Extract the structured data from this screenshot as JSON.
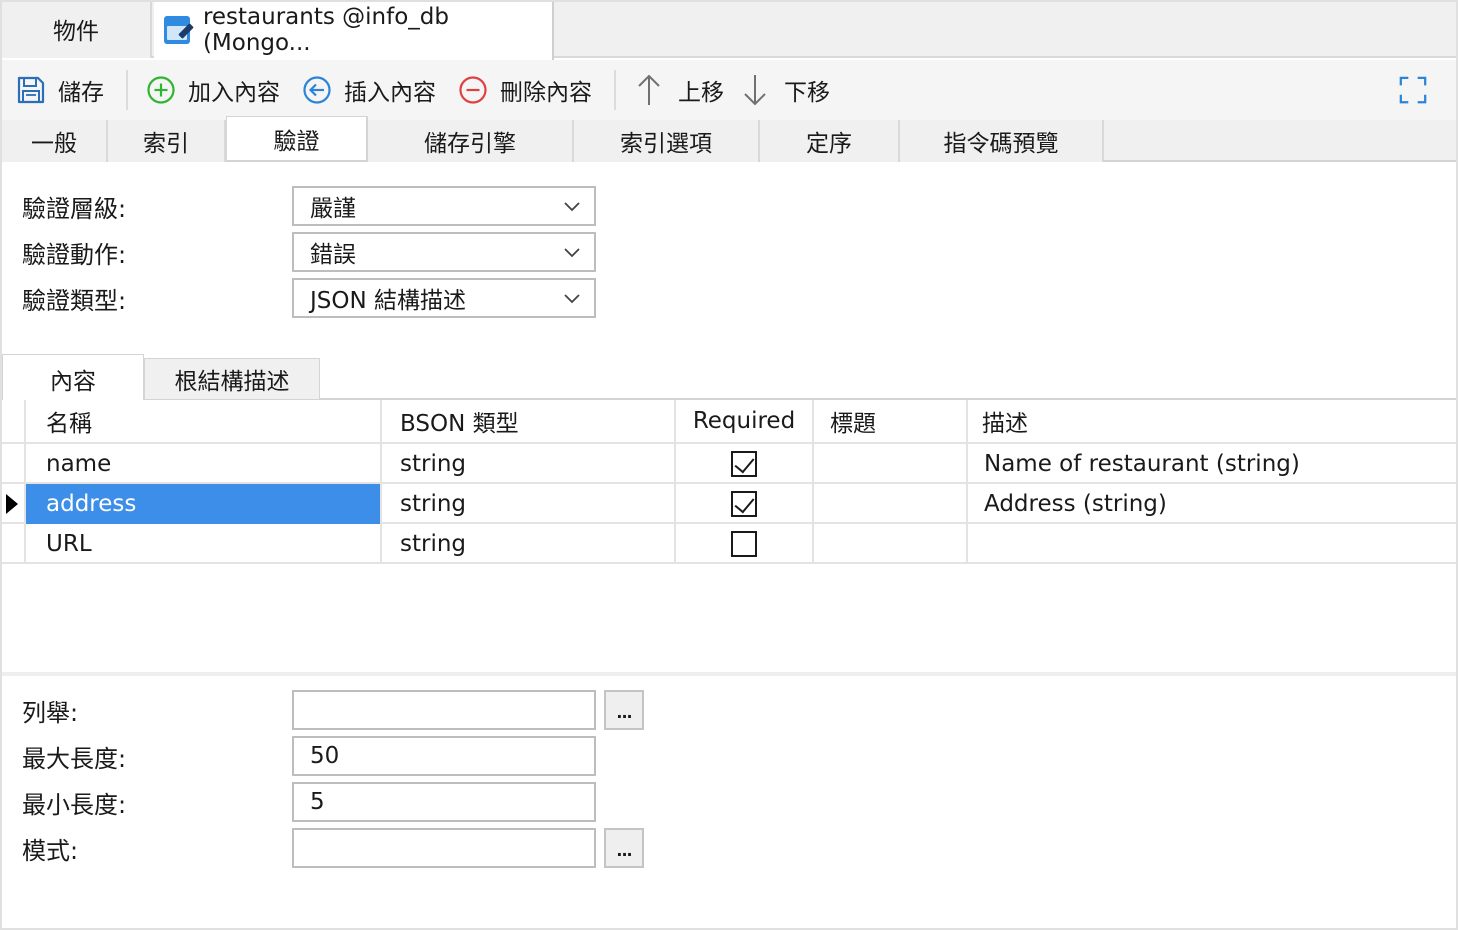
{
  "doc_tabs": {
    "objects": "物件",
    "collection": "restaurants @info_db (Mongo..."
  },
  "toolbar": {
    "save": "儲存",
    "add_field": "加入內容",
    "insert_field": "插入內容",
    "delete_field": "刪除內容",
    "move_up": "上移",
    "move_down": "下移"
  },
  "main_tabs": [
    {
      "label": "一般"
    },
    {
      "label": "索引"
    },
    {
      "label": "驗證"
    },
    {
      "label": "儲存引擎"
    },
    {
      "label": "索引選項"
    },
    {
      "label": "定序"
    },
    {
      "label": "指令碼預覽"
    }
  ],
  "validation": {
    "level_label": "驗證層級:",
    "level_value": "嚴謹",
    "action_label": "驗證動作:",
    "action_value": "錯誤",
    "type_label": "驗證類型:",
    "type_value": "JSON 結構描述"
  },
  "sub_tabs": {
    "content": "內容",
    "root_schema": "根結構描述"
  },
  "grid": {
    "headers": {
      "name": "名稱",
      "bson_type": "BSON 類型",
      "required": "Required",
      "title": "標題",
      "description": "描述"
    },
    "rows": [
      {
        "name": "name",
        "bson_type": "string",
        "required": true,
        "title": "",
        "description": "Name of restaurant (string)"
      },
      {
        "name": "address",
        "bson_type": "string",
        "required": true,
        "title": "",
        "description": "Address (string)"
      },
      {
        "name": "URL",
        "bson_type": "string",
        "required": false,
        "title": "",
        "description": ""
      }
    ],
    "selected_row": 1
  },
  "properties": {
    "enum_label": "列舉:",
    "enum_value": "",
    "enum_button": "...",
    "max_length_label": "最大長度:",
    "max_length_value": "50",
    "min_length_label": "最小長度:",
    "min_length_value": "5",
    "pattern_label": "模式:",
    "pattern_value": "",
    "pattern_button": "..."
  },
  "colors": {
    "accent": "#3d8ee8",
    "add": "#2fb52f",
    "insert": "#2a85d8",
    "delete": "#e04040",
    "fullscreen": "#2a85d8"
  },
  "icons": {
    "save": "floppy-disk-icon",
    "add": "plus-circle-icon",
    "insert": "arrow-left-circle-icon",
    "delete": "minus-circle-icon",
    "up": "arrow-up-icon",
    "down": "arrow-down-icon",
    "fullscreen": "fullscreen-icon"
  }
}
